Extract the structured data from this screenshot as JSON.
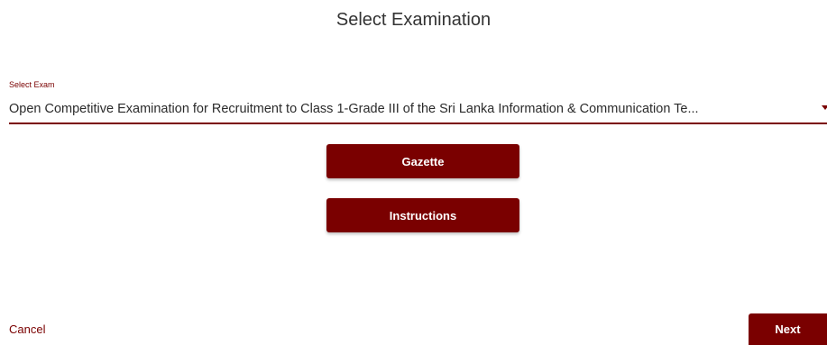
{
  "dialog": {
    "title": "Select Examination"
  },
  "exam_select": {
    "label": "Select Exam",
    "value": "Open Competitive Examination for Recruitment to Class 1-Grade III of the Sri Lanka Information & Communication Te...",
    "icon": "caret-down-icon"
  },
  "buttons": {
    "gazette": "Gazette",
    "instructions": "Instructions"
  },
  "footer": {
    "cancel": "Cancel",
    "next": "Next"
  },
  "colors": {
    "accent": "#7a0000",
    "background": "#ffffff"
  }
}
